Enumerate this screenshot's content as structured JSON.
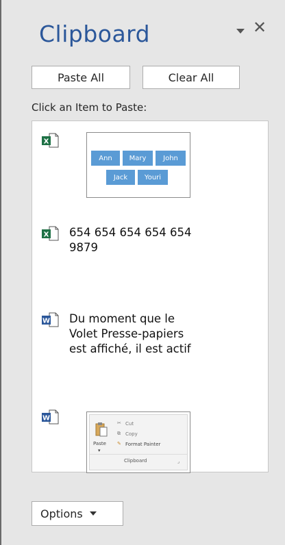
{
  "pane": {
    "title": "Clipboard",
    "paste_all": "Paste All",
    "clear_all": "Clear All",
    "instruction": "Click an Item to Paste:",
    "options": "Options"
  },
  "items": [
    {
      "app": "excel",
      "type": "image",
      "names": [
        "Ann",
        "Mary",
        "John",
        "Jack",
        "Youri"
      ]
    },
    {
      "app": "excel",
      "type": "text",
      "line1": "654 654 654 654 654",
      "line2": "9879"
    },
    {
      "app": "word",
      "type": "text",
      "line1": "Du moment que le",
      "line2": "Volet Presse-papiers",
      "line3": "est affiché, il est actif"
    },
    {
      "app": "word",
      "type": "image",
      "ribbon": {
        "paste": "Paste",
        "cut": "Cut",
        "copy": "Copy",
        "format_painter": "Format Painter",
        "group": "Clipboard"
      }
    }
  ],
  "colors": {
    "title": "#2b579a",
    "excel": "#1e7145",
    "word": "#2b579a",
    "tag": "#5a9bd5"
  }
}
